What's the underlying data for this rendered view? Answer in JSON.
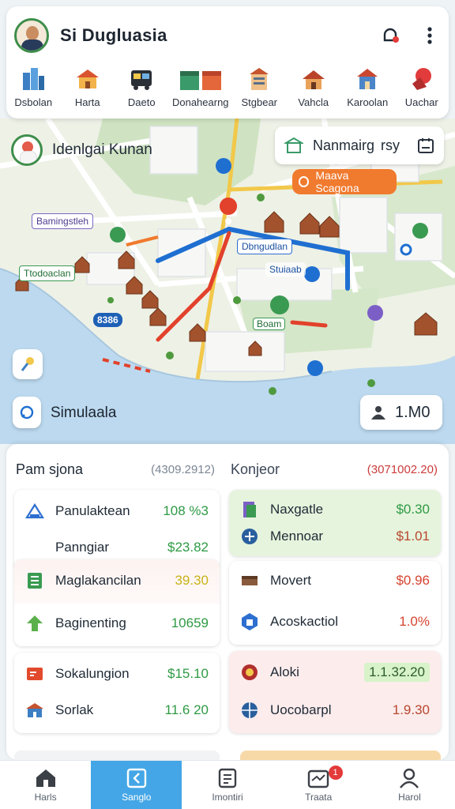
{
  "header": {
    "title": "Si Dugluasia",
    "icons": [
      "bell-alert-icon",
      "more-vertical-icon"
    ],
    "categories": [
      {
        "label": "Dsbolan",
        "icon": "city-icon"
      },
      {
        "label": "Harta",
        "icon": "market-icon"
      },
      {
        "label": "Daeto",
        "icon": "bus-icon"
      },
      {
        "label": "Donahearng",
        "icon": "shops-icon"
      },
      {
        "label": "Stgbear",
        "icon": "building-icon"
      },
      {
        "label": "Vahcla",
        "icon": "house-icon"
      },
      {
        "label": "Karoolan",
        "icon": "school-icon"
      },
      {
        "label": "Uachar",
        "icon": "pin-icon"
      }
    ]
  },
  "map": {
    "location_name": "Idenlgai Kunan",
    "nav_label": "Nanmairg",
    "nav_suffix": "rsy",
    "orange_pill": "Maava Scagona",
    "labels": {
      "purple": "Bamingstleh",
      "green_left": "Ttodoaclan",
      "blue_route": "Dbngudlan",
      "center": "Stuiaab",
      "badge": "8386",
      "green_small": "Boam"
    },
    "simulation_label": "Simulaala",
    "rating": "1.M0",
    "route_colors": {
      "blue": "#1f6fd1",
      "red": "#e2412b",
      "water": "#bcd9ef"
    }
  },
  "panel": {
    "left": {
      "title": "Pam sjona",
      "total": "(4309.2912)",
      "cards": [
        {
          "rows": [
            {
              "name": "Panulaktean",
              "value": "108 %3",
              "icon": "shelter-icon",
              "color": "green"
            },
            {
              "name": "Panngiar",
              "value": "$23.82",
              "icon": "none",
              "color": "green"
            }
          ]
        },
        {
          "rows": [
            {
              "name": "Maglakancilan",
              "value": "39.30",
              "icon": "ledger-icon",
              "color": "yellow"
            },
            {
              "name": "Baginenting",
              "value": "10659",
              "icon": "arrow-up-icon",
              "color": "green"
            }
          ]
        },
        {
          "rows": [
            {
              "name": "Sokalungion",
              "value": "$15.10",
              "icon": "tool-icon",
              "color": "green"
            },
            {
              "name": "Sorlak",
              "value": "11.6 20",
              "icon": "store-icon",
              "color": "green"
            }
          ]
        }
      ]
    },
    "right": {
      "title": "Konjeor",
      "total": "(3071002.20)",
      "cards": [
        {
          "rows": [
            {
              "name": "Naxgatle",
              "value": "$0.30",
              "icon": "book-icon",
              "color": "green"
            },
            {
              "name": "Mennoar",
              "value": "$1.01",
              "icon": "plus-circle-icon",
              "color": "darkred"
            }
          ]
        },
        {
          "rows": [
            {
              "name": "Movert",
              "value": "$0.96",
              "icon": "box-icon",
              "color": "red"
            },
            {
              "name": "Acoskactiol",
              "value": "1.0%",
              "icon": "hexagon-icon",
              "color": "red"
            }
          ]
        },
        {
          "rows": [
            {
              "name": "Aloki",
              "value": "1.1.32.20",
              "icon": "badge-icon",
              "color": "highlight"
            },
            {
              "name": "Uocobarpl",
              "value": "1.9.30",
              "icon": "globe-icon",
              "color": "darkred"
            }
          ]
        }
      ]
    }
  },
  "bottom_nav": [
    {
      "label": "Harls",
      "icon": "home-icon"
    },
    {
      "label": "Sanglo",
      "icon": "compass-icon",
      "active": true
    },
    {
      "label": "Imontiri",
      "icon": "document-icon"
    },
    {
      "label": "Traata",
      "icon": "inbox-icon",
      "badge": "1"
    },
    {
      "label": "Harol",
      "icon": "user-icon"
    }
  ]
}
